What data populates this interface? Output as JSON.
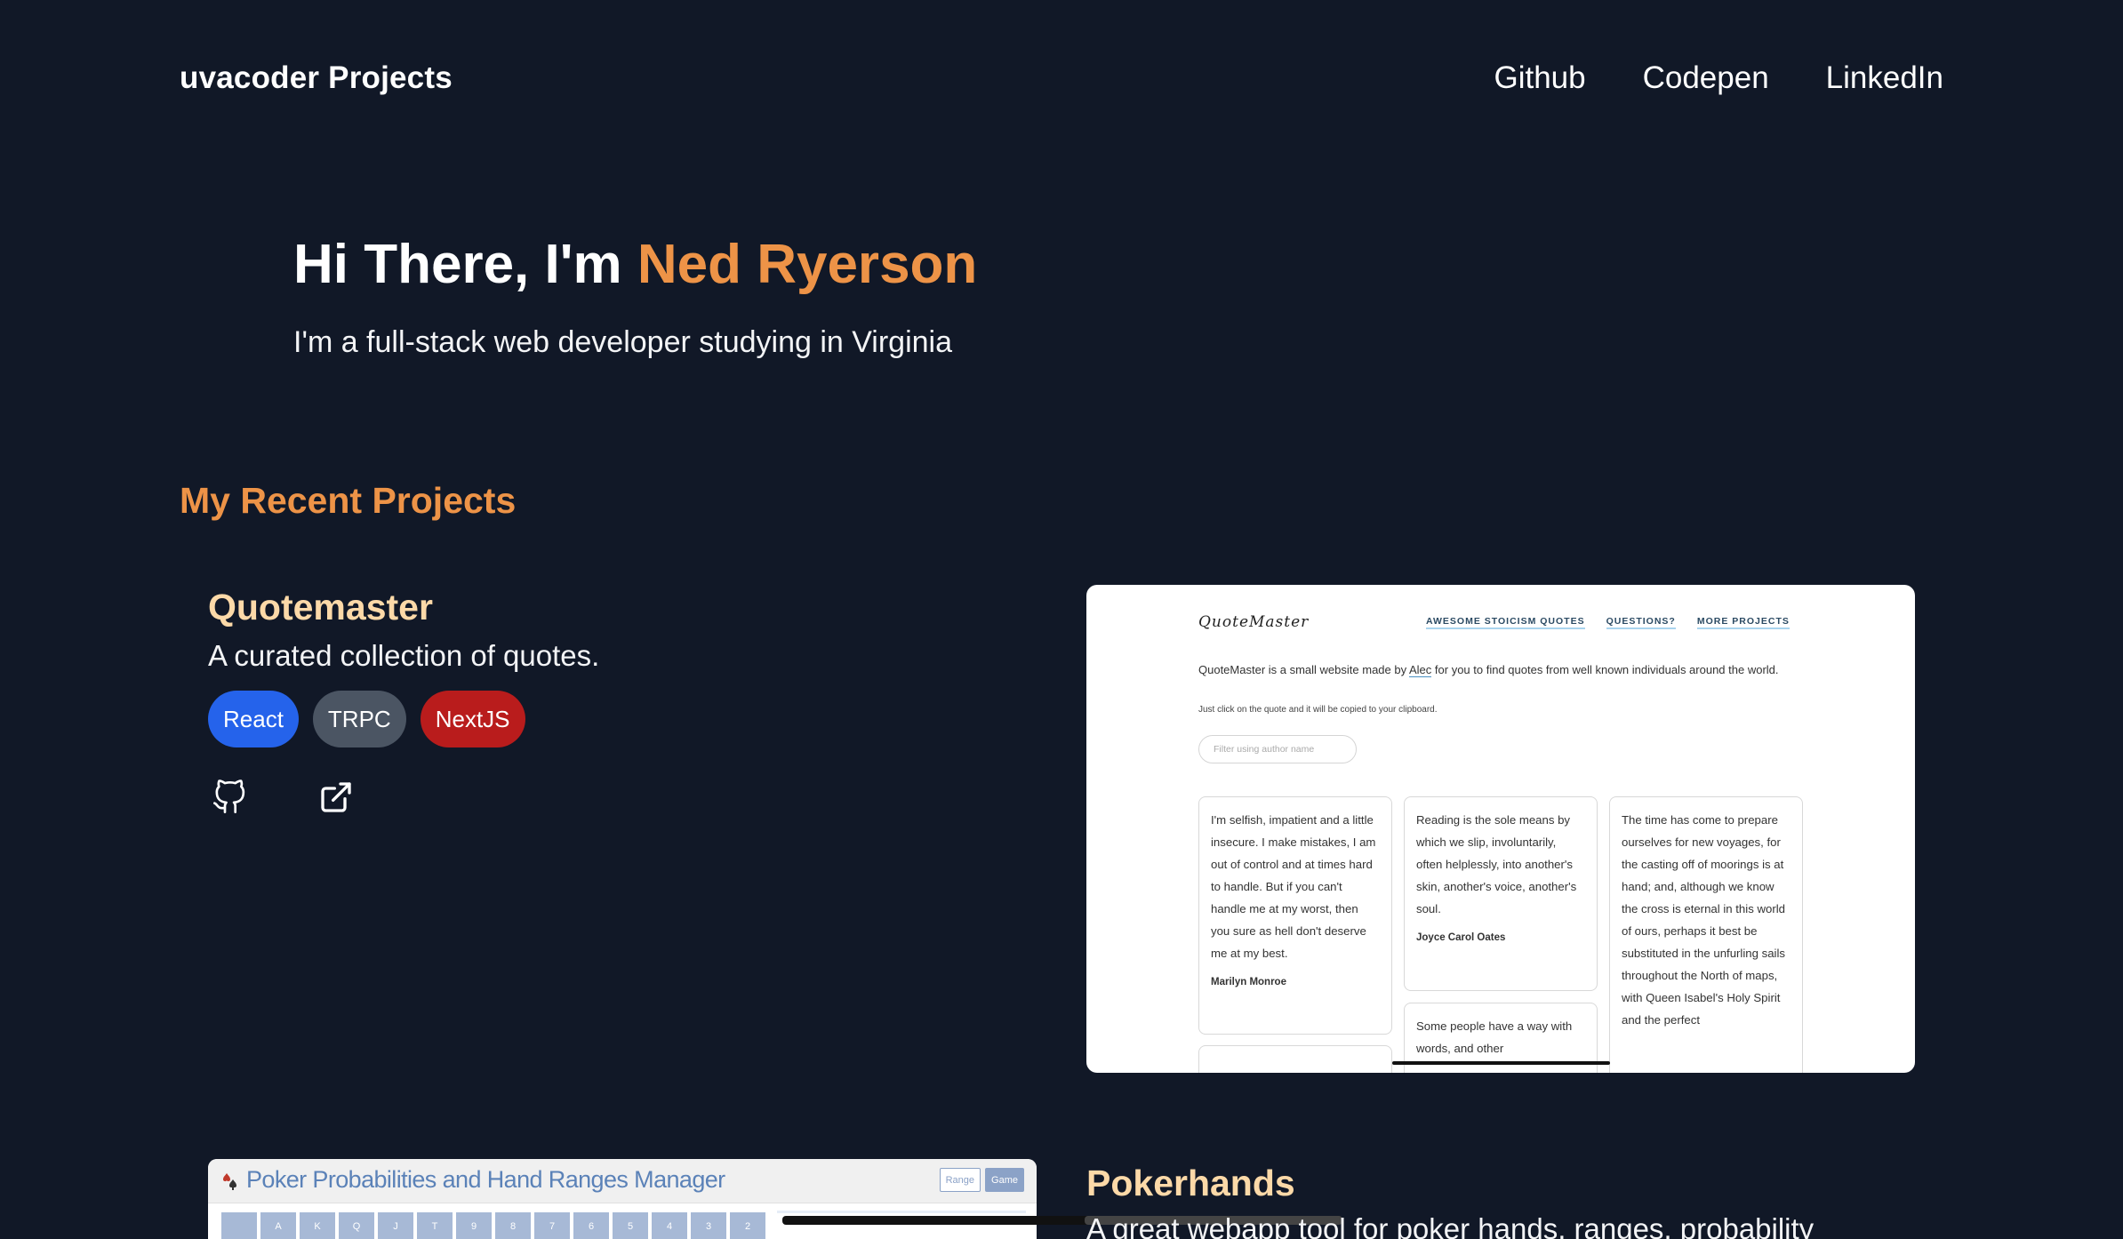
{
  "nav": {
    "brand": "uvacoder Projects",
    "links": [
      "Github",
      "Codepen",
      "LinkedIn"
    ]
  },
  "hero": {
    "greeting": "Hi There, I'm",
    "name": "Ned Ryerson",
    "subtitle": "I'm a full-stack web developer studying in Virginia"
  },
  "section_title": "My Recent Projects",
  "projects": [
    {
      "title": "Quotemaster",
      "description": "A curated collection of quotes.",
      "tags": [
        "React",
        "TRPC",
        "NextJS"
      ],
      "icons": [
        "github-icon",
        "external-link-icon"
      ],
      "screenshot": {
        "logo": "QuoteMaster",
        "nav": [
          "AWESOME STOICISM QUOTES",
          "QUESTIONS?",
          "MORE PROJECTS"
        ],
        "intro_before": "QuoteMaster is a small website made by ",
        "intro_link": "Alec",
        "intro_after": " for you to find quotes from well known individuals around the world.",
        "hint": "Just click on the quote and it will be copied to your clipboard.",
        "filter_placeholder": "Filter using author name",
        "cards": [
          {
            "text": "I'm selfish, impatient and a little insecure. I make mistakes, I am out of control and at times hard to handle. But if you can't handle me at my worst, then you sure as hell don't deserve me at my best.",
            "author": "Marilyn Monroe"
          },
          {
            "text": "Reading is the sole means by which we slip, involuntarily, often helplessly, into another's skin, another's voice, another's soul.",
            "author": "Joyce Carol Oates"
          },
          {
            "text": "The time has come to prepare ourselves for new voyages, for the casting off of moorings is at hand; and, although we know the cross is eternal in this world of ours, perhaps it best be substituted in the unfurling sails throughout the North of maps, with Queen Isabel's Holy Spirit and the perfect",
            "author": ""
          },
          {
            "text": "Some people have a way with words, and other",
            "author": ""
          }
        ]
      }
    },
    {
      "title": "Pokerhands",
      "description": "A great webapp tool for poker hands, ranges, probability",
      "screenshot": {
        "title": "Poker Probabilities and Hand Ranges Manager",
        "buttons": [
          "Range",
          "Game"
        ],
        "ranks": [
          "",
          "A",
          "K",
          "Q",
          "J",
          "T",
          "9",
          "8",
          "7",
          "6",
          "5",
          "4",
          "3",
          "2"
        ]
      }
    }
  ],
  "colors": {
    "background": "#111827",
    "accent": "#ed9347",
    "project_title": "#fcd9a8",
    "react": "#2563eb",
    "trpc": "#4b5563",
    "nextjs": "#b91c1c"
  }
}
